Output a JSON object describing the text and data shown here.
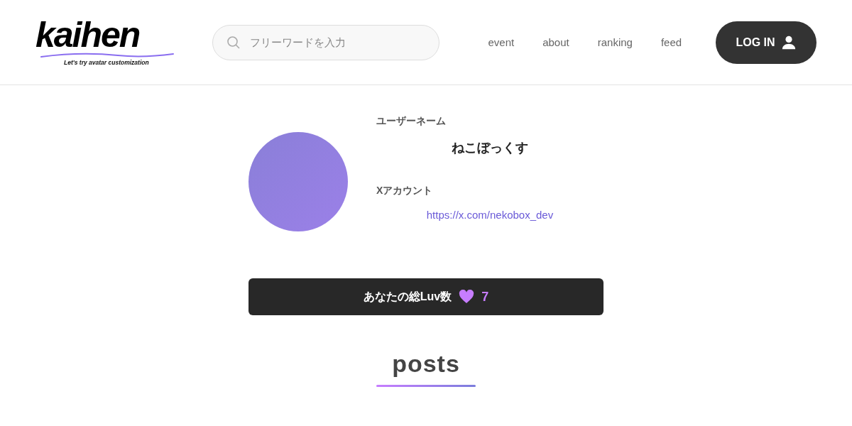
{
  "logo": {
    "wordmark": "kaihen",
    "tagline": "Let's try avatar customization"
  },
  "search": {
    "placeholder": "フリーワードを入力"
  },
  "nav": [
    {
      "label": "event"
    },
    {
      "label": "about"
    },
    {
      "label": "ranking"
    },
    {
      "label": "feed"
    }
  ],
  "login_button": {
    "label": "LOG IN"
  },
  "profile": {
    "username_label": "ユーザーネーム",
    "username": "ねこぼっくす",
    "x_label": "Xアカウント",
    "x_url": "https://x.com/nekobox_dev"
  },
  "luv_bar": {
    "label": "あなたの総Luv数",
    "count": "7"
  },
  "posts": {
    "heading": "posts"
  }
}
